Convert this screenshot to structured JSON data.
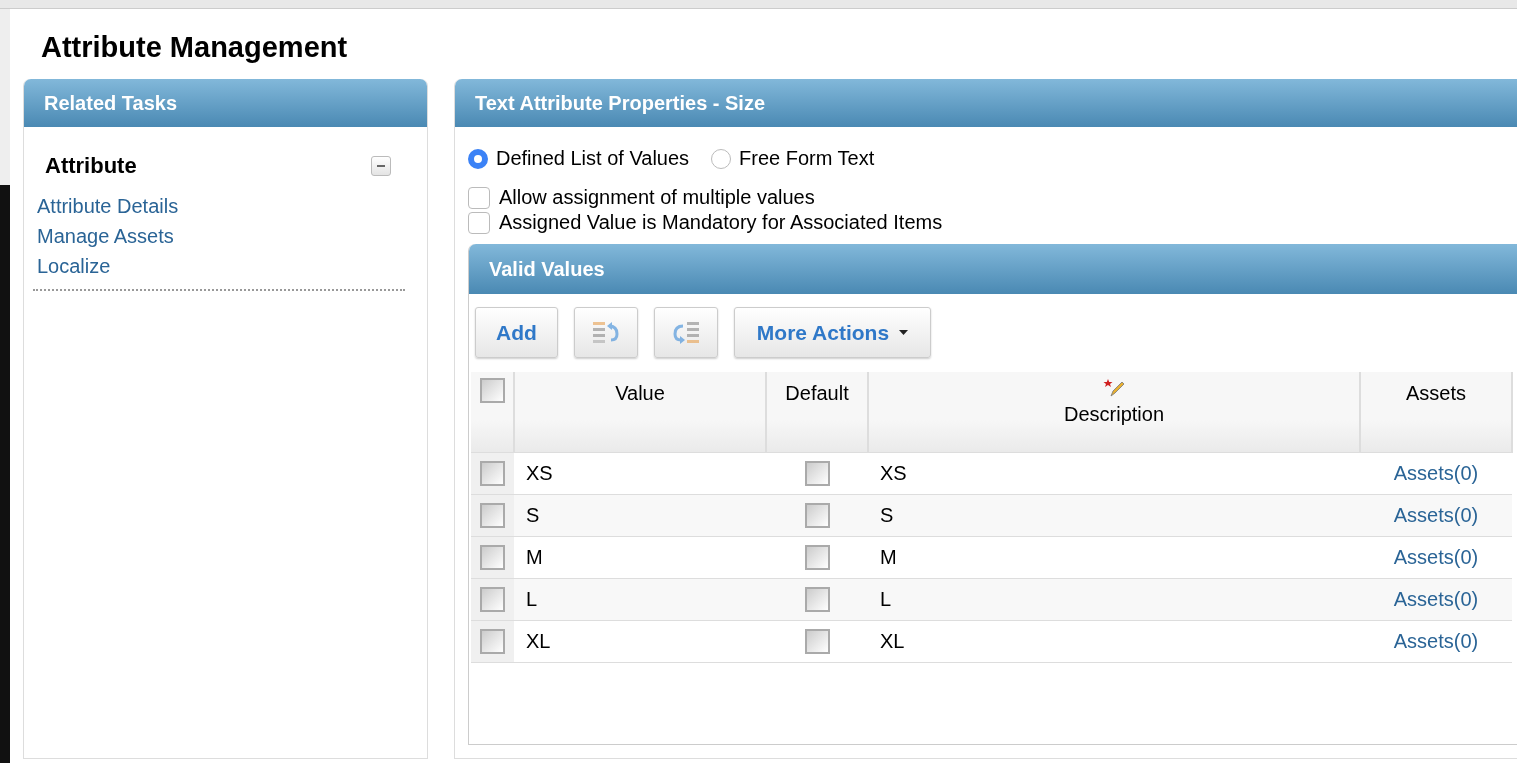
{
  "page_title": "Attribute Management",
  "related_tasks": {
    "title": "Related Tasks",
    "section": {
      "title": "Attribute",
      "expanded": true,
      "links": [
        "Attribute Details",
        "Manage Assets",
        "Localize"
      ]
    }
  },
  "properties": {
    "title": "Text Attribute Properties - Size",
    "value_type": [
      {
        "label": "Defined List of Values",
        "selected": true
      },
      {
        "label": "Free Form Text",
        "selected": false
      }
    ],
    "options": [
      {
        "label": "Allow assignment of multiple values",
        "checked": false
      },
      {
        "label": "Assigned Value is Mandatory for Associated Items",
        "checked": false
      }
    ]
  },
  "valid_values": {
    "title": "Valid Values",
    "toolbar": {
      "add": "Add",
      "more_actions": "More Actions"
    },
    "columns": [
      "Value",
      "Default",
      "Description",
      "Assets"
    ],
    "select_all": false,
    "rows": [
      {
        "value": "XS",
        "default": false,
        "description": "XS",
        "assets": "Assets(0)",
        "selected": false
      },
      {
        "value": "S",
        "default": false,
        "description": "S",
        "assets": "Assets(0)",
        "selected": false
      },
      {
        "value": "M",
        "default": false,
        "description": "M",
        "assets": "Assets(0)",
        "selected": false
      },
      {
        "value": "L",
        "default": false,
        "description": "L",
        "assets": "Assets(0)",
        "selected": false
      },
      {
        "value": "XL",
        "default": false,
        "description": "XL",
        "assets": "Assets(0)",
        "selected": false
      }
    ]
  }
}
